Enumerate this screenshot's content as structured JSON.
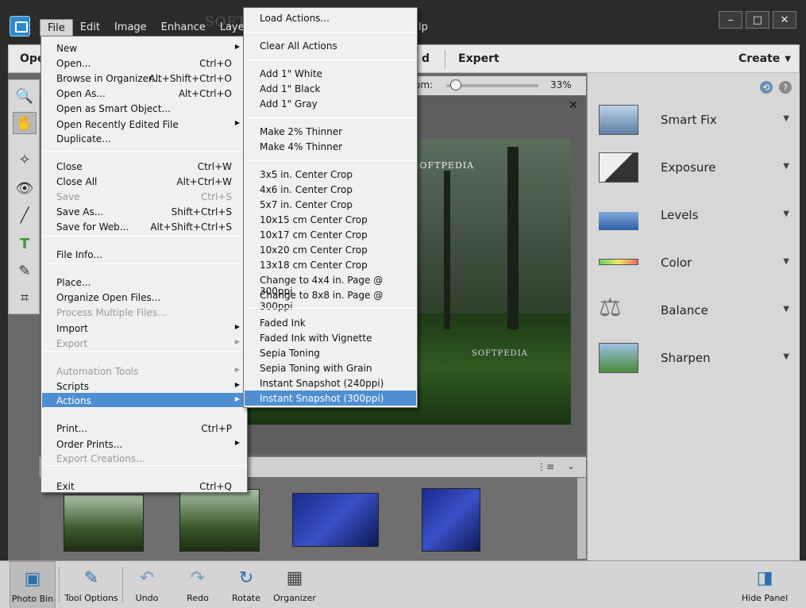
{
  "menubar": {
    "items": [
      "File",
      "Edit",
      "Image",
      "Enhance",
      "Layer"
    ],
    "tail": "lp",
    "watermark": "SOFTPEDIA"
  },
  "window_controls": {
    "minimize": "–",
    "maximize": "□",
    "close": "✕"
  },
  "modes": {
    "quick": "Ope",
    "guided": "d",
    "expert": "Expert",
    "create": "Create"
  },
  "zoom": {
    "label": "om:",
    "value": "33%",
    "fraction": 0.1
  },
  "photo": {
    "logo": "SOFTPEDIA",
    "logo2": "SOFTPEDIA"
  },
  "adjustments": [
    {
      "label": "Smart Fix",
      "icon": "smart-fix-icon"
    },
    {
      "label": "Exposure",
      "icon": "exposure-icon"
    },
    {
      "label": "Levels",
      "icon": "levels-icon"
    },
    {
      "label": "Color",
      "icon": "color-icon"
    },
    {
      "label": "Balance",
      "icon": "balance-icon"
    },
    {
      "label": "Sharpen",
      "icon": "sharpen-icon"
    }
  ],
  "bottom_bar": {
    "photo_bin": "Photo Bin",
    "tool_options": "Tool Options",
    "undo": "Undo",
    "redo": "Redo",
    "rotate": "Rotate",
    "organizer": "Organizer",
    "hide_panel": "Hide Panel"
  },
  "file_menu": {
    "items": [
      {
        "label": "New",
        "shortcut": "",
        "submenu": true,
        "disabled": false
      },
      {
        "label": "Open...",
        "shortcut": "Ctrl+O",
        "submenu": false,
        "disabled": false
      },
      {
        "label": "Browse in Organizer...",
        "shortcut": "Alt+Shift+Ctrl+O",
        "submenu": false,
        "disabled": false
      },
      {
        "label": "Open As...",
        "shortcut": "Alt+Ctrl+O",
        "submenu": false,
        "disabled": false
      },
      {
        "label": "Open as Smart Object...",
        "shortcut": "",
        "submenu": false,
        "disabled": false
      },
      {
        "label": "Open Recently Edited File",
        "shortcut": "",
        "submenu": true,
        "disabled": false
      },
      {
        "label": "Duplicate...",
        "shortcut": "",
        "submenu": false,
        "disabled": false
      },
      {
        "label": "Close",
        "shortcut": "Ctrl+W",
        "submenu": false,
        "disabled": false
      },
      {
        "label": "Close All",
        "shortcut": "Alt+Ctrl+W",
        "submenu": false,
        "disabled": false
      },
      {
        "label": "Save",
        "shortcut": "Ctrl+S",
        "submenu": false,
        "disabled": true
      },
      {
        "label": "Save As...",
        "shortcut": "Shift+Ctrl+S",
        "submenu": false,
        "disabled": false
      },
      {
        "label": "Save for Web...",
        "shortcut": "Alt+Shift+Ctrl+S",
        "submenu": false,
        "disabled": false
      },
      {
        "label": "File Info...",
        "shortcut": "",
        "submenu": false,
        "disabled": false
      },
      {
        "label": "Place...",
        "shortcut": "",
        "submenu": false,
        "disabled": false
      },
      {
        "label": "Organize Open Files...",
        "shortcut": "",
        "submenu": false,
        "disabled": false
      },
      {
        "label": "Process Multiple Files...",
        "shortcut": "",
        "submenu": false,
        "disabled": true
      },
      {
        "label": "Import",
        "shortcut": "",
        "submenu": true,
        "disabled": false
      },
      {
        "label": "Export",
        "shortcut": "",
        "submenu": true,
        "disabled": true
      },
      {
        "label": "Automation Tools",
        "shortcut": "",
        "submenu": true,
        "disabled": true
      },
      {
        "label": "Scripts",
        "shortcut": "",
        "submenu": true,
        "disabled": false
      },
      {
        "label": "Actions",
        "shortcut": "",
        "submenu": true,
        "disabled": false,
        "highlight": true
      },
      {
        "label": "Print...",
        "shortcut": "Ctrl+P",
        "submenu": false,
        "disabled": false
      },
      {
        "label": "Order Prints...",
        "shortcut": "",
        "submenu": true,
        "disabled": false
      },
      {
        "label": "Export Creations...",
        "shortcut": "",
        "submenu": false,
        "disabled": true
      },
      {
        "label": "Exit",
        "shortcut": "Ctrl+Q",
        "submenu": false,
        "disabled": false
      }
    ]
  },
  "actions_menu": {
    "items": [
      "Load Actions...",
      "Clear All Actions",
      "Add 1\" White",
      "Add 1\" Black",
      "Add 1\" Gray",
      "Make 2% Thinner",
      "Make 4% Thinner",
      "3x5 in. Center Crop",
      "4x6 in. Center Crop",
      "5x7 in. Center Crop",
      "10x15 cm Center Crop",
      "10x17 cm Center Crop",
      "10x20 cm Center Crop",
      "13x18 cm Center Crop",
      "Change to 4x4 in. Page @ 300ppi",
      "Change to 8x8 in. Page @ 300ppi",
      "Faded Ink",
      "Faded Ink with Vignette",
      "Sepia Toning",
      "Sepia Toning with Grain",
      "Instant Snapshot (240ppi)",
      "Instant Snapshot (300ppi)"
    ],
    "highlighted": "Instant Snapshot (300ppi)"
  }
}
